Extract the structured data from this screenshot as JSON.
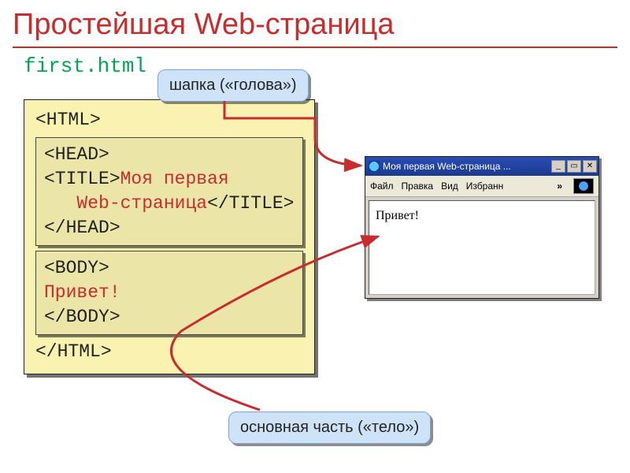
{
  "slide": {
    "title": "Простейшая Web-страница",
    "filename": "first.html"
  },
  "code": {
    "html_open": "<HTML>",
    "html_close": "</HTML>",
    "head_open": "<HEAD>",
    "head_close": "</HEAD>",
    "title_open": "<TITLE>",
    "title_close": "</TITLE>",
    "title_text_1": "Моя первая",
    "title_text_2": "Web-страница",
    "body_open": "<BODY>",
    "body_close": "</BODY>",
    "body_text": "Привет!"
  },
  "callouts": {
    "top": "шапка («голова»)",
    "bottom": "основная часть («тело»)"
  },
  "browser": {
    "title": "Моя первая Web-страница ...",
    "menus": {
      "file": "Файл",
      "edit": "Правка",
      "view": "Вид",
      "fav": "Избранн"
    },
    "chevron": "»",
    "window_controls": {
      "min": "_",
      "max": "▭",
      "close": "✕"
    },
    "content": "Привет!"
  }
}
